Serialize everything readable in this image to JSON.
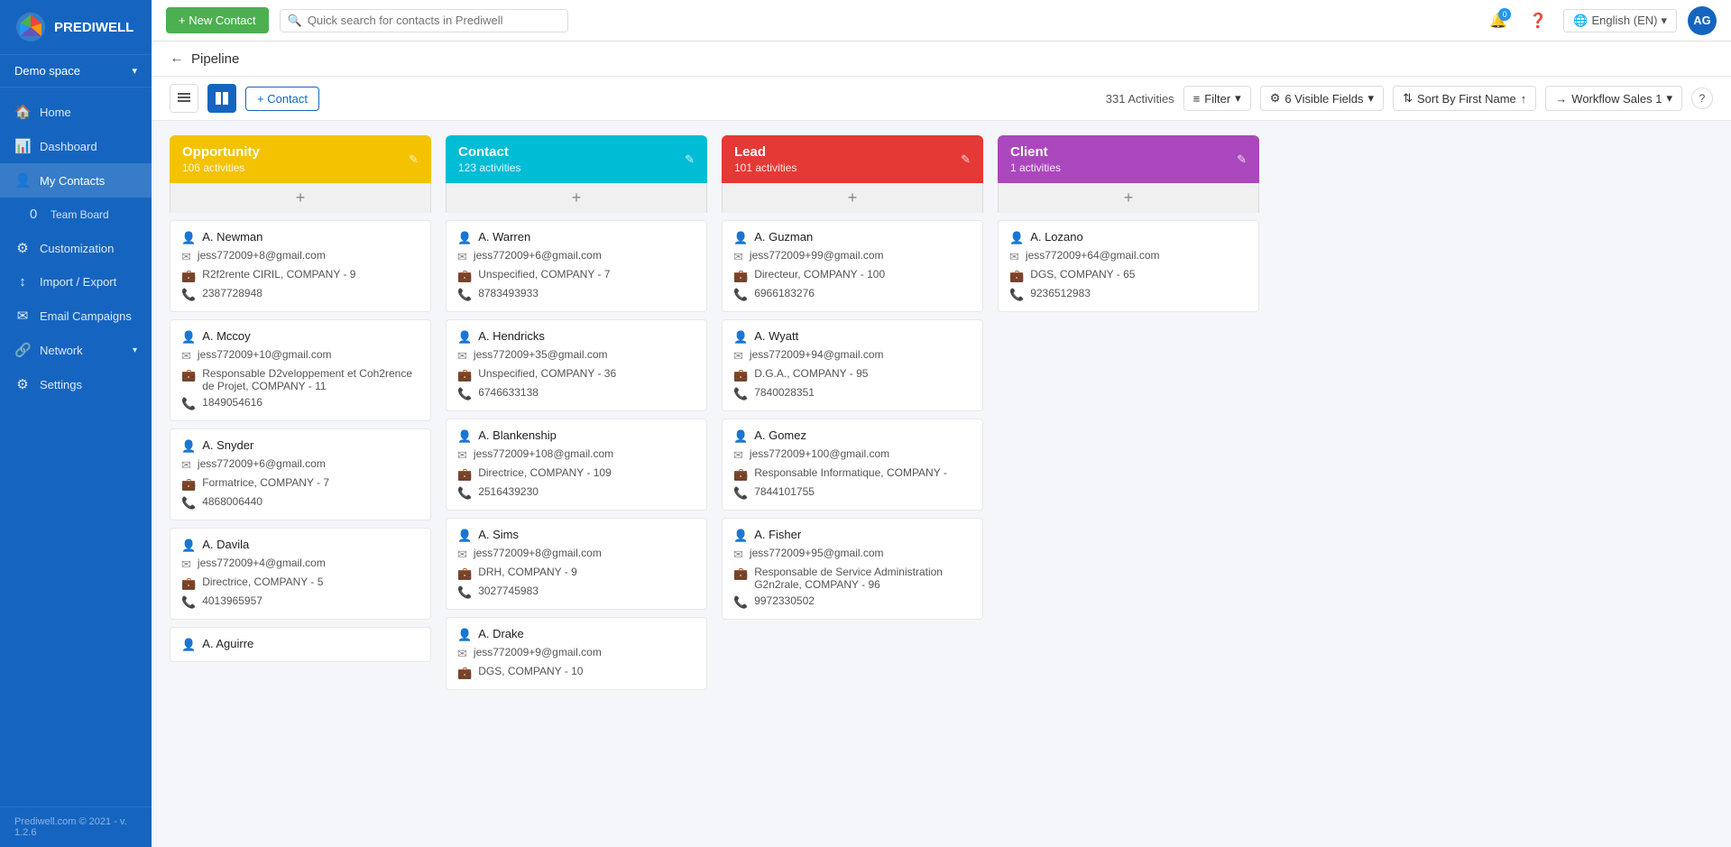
{
  "sidebar": {
    "logo_text": "PREDIWELL",
    "demo_space": "Demo space",
    "nav_items": [
      {
        "id": "home",
        "label": "Home",
        "icon": "🏠",
        "active": false
      },
      {
        "id": "dashboard",
        "label": "Dashboard",
        "icon": "📊",
        "active": false
      },
      {
        "id": "my-contacts",
        "label": "My Contacts",
        "icon": "👤",
        "active": true
      },
      {
        "id": "team-board",
        "label": "Team Board",
        "icon": "📋",
        "active": false
      },
      {
        "id": "customization",
        "label": "Customization",
        "icon": "⚙",
        "active": false
      },
      {
        "id": "import-export",
        "label": "Import / Export",
        "icon": "↕",
        "active": false
      },
      {
        "id": "email-campaigns",
        "label": "Email Campaigns",
        "icon": "✉",
        "active": false
      },
      {
        "id": "network",
        "label": "Network",
        "icon": "🔗",
        "active": false
      },
      {
        "id": "settings",
        "label": "Settings",
        "icon": "⚙",
        "active": false
      }
    ],
    "footer": "Prediwell.com © 2021 - v. 1.2.6"
  },
  "topbar": {
    "new_contact_label": "+ New Contact",
    "search_placeholder": "Quick search for contacts in Prediwell",
    "notification_count": "0",
    "language_label": "English (EN)",
    "avatar_initials": "AG"
  },
  "breadcrumb": {
    "back_icon": "←",
    "title": "Pipeline"
  },
  "toolbar": {
    "activities_count": "331 Activities",
    "filter_label": "Filter",
    "visible_fields_label": "6 Visible Fields",
    "sort_label": "Sort By First Name",
    "workflow_label": "Workflow Sales 1",
    "add_contact_label": "+ Contact"
  },
  "columns": [
    {
      "id": "opportunity",
      "title": "Opportunity",
      "activities": "106 activities",
      "color": "#f5c200",
      "cards": [
        {
          "name": "A. Newman",
          "email": "jess772009+8@gmail.com",
          "company": "R2f2rente CIRIL, COMPANY - 9",
          "phone": "2387728948"
        },
        {
          "name": "A. Mccoy",
          "email": "jess772009+10@gmail.com",
          "company": "Responsable D2veloppement et Coh2rence de Projet, COMPANY - 11",
          "phone": "1849054616"
        },
        {
          "name": "A. Snyder",
          "email": "jess772009+6@gmail.com",
          "company": "Formatrice, COMPANY - 7",
          "phone": "4868006440"
        },
        {
          "name": "A. Davila",
          "email": "jess772009+4@gmail.com",
          "company": "Directrice, COMPANY - 5",
          "phone": "4013965957"
        },
        {
          "name": "A. Aguirre",
          "email": "",
          "company": "",
          "phone": ""
        }
      ]
    },
    {
      "id": "contact",
      "title": "Contact",
      "activities": "123 activities",
      "color": "#00bcd4",
      "cards": [
        {
          "name": "A. Warren",
          "email": "jess772009+6@gmail.com",
          "company": "Unspecified, COMPANY - 7",
          "phone": "8783493933"
        },
        {
          "name": "A. Hendricks",
          "email": "jess772009+35@gmail.com",
          "company": "Unspecified, COMPANY - 36",
          "phone": "6746633138"
        },
        {
          "name": "A. Blankenship",
          "email": "jess772009+108@gmail.com",
          "company": "Directrice, COMPANY - 109",
          "phone": "2516439230"
        },
        {
          "name": "A. Sims",
          "email": "jess772009+8@gmail.com",
          "company": "DRH, COMPANY - 9",
          "phone": "3027745983"
        },
        {
          "name": "A. Drake",
          "email": "jess772009+9@gmail.com",
          "company": "DGS, COMPANY - 10",
          "phone": ""
        }
      ]
    },
    {
      "id": "lead",
      "title": "Lead",
      "activities": "101 activities",
      "color": "#e53935",
      "cards": [
        {
          "name": "A. Guzman",
          "email": "jess772009+99@gmail.com",
          "company": "Directeur, COMPANY - 100",
          "phone": "6966183276"
        },
        {
          "name": "A. Wyatt",
          "email": "jess772009+94@gmail.com",
          "company": "D.G.A., COMPANY - 95",
          "phone": "7840028351"
        },
        {
          "name": "A. Gomez",
          "email": "jess772009+100@gmail.com",
          "company": "Responsable Informatique, COMPANY -",
          "phone": "7844101755"
        },
        {
          "name": "A. Fisher",
          "email": "jess772009+95@gmail.com",
          "company": "Responsable de Service Administration G2n2rale, COMPANY - 96",
          "phone": "9972330502"
        }
      ]
    },
    {
      "id": "client",
      "title": "Client",
      "activities": "1 activities",
      "color": "#ab47bc",
      "cards": [
        {
          "name": "A. Lozano",
          "email": "jess772009+64@gmail.com",
          "company": "DGS, COMPANY - 65",
          "phone": "9236512983"
        }
      ]
    }
  ]
}
